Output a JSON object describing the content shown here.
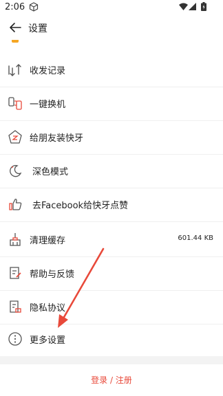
{
  "status_bar": {
    "time": "2:06"
  },
  "header": {
    "title": "设置"
  },
  "menu": [
    {
      "label": "收发记录",
      "value": ""
    },
    {
      "label": "一键换机",
      "value": ""
    },
    {
      "label": "给朋友装快牙",
      "value": ""
    },
    {
      "label": "深色模式",
      "value": ""
    },
    {
      "label": "去Facebook给快牙点赞",
      "value": ""
    },
    {
      "label": "清理缓存",
      "value": "601.44 KB"
    },
    {
      "label": "帮助与反馈",
      "value": ""
    },
    {
      "label": "隐私协议",
      "value": ""
    },
    {
      "label": "更多设置",
      "value": ""
    }
  ],
  "login_label": "登录 / 注册",
  "colors": {
    "accent": "#e8493a",
    "arrow": "#e8493a",
    "icon": "#555555"
  }
}
